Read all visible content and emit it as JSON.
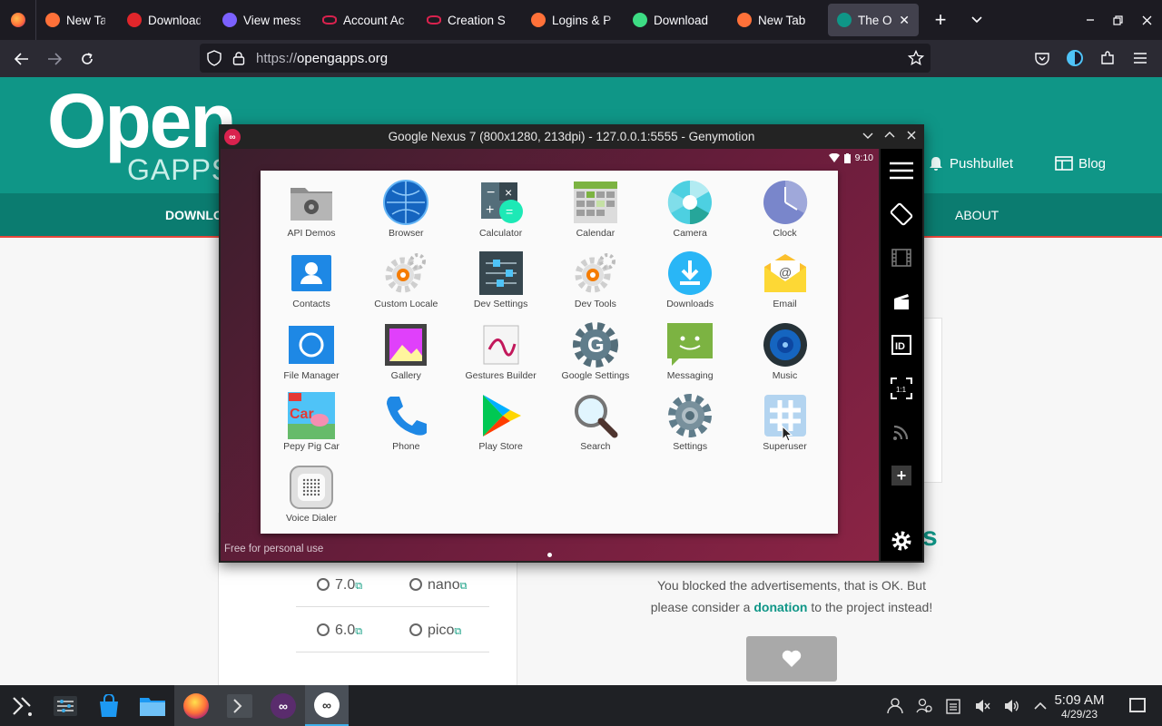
{
  "browser": {
    "tabs": [
      {
        "title": "New Tab",
        "icon": "firefox-icon",
        "color": "#ff7139"
      },
      {
        "title": "Download",
        "icon": "v-icon",
        "color": "#e0262b"
      },
      {
        "title": "View mess",
        "icon": "at-icon",
        "color": "#7b61ff"
      },
      {
        "title": "Account Ac",
        "icon": "genymotion-icon",
        "color": "#d9224e"
      },
      {
        "title": "Creation S",
        "icon": "genymotion-icon",
        "color": "#d9224e"
      },
      {
        "title": "Logins & P",
        "icon": "firefox-icon",
        "color": "#ff7139"
      },
      {
        "title": "Download",
        "icon": "android-icon",
        "color": "#3ddc84"
      },
      {
        "title": "New Tab",
        "icon": "firefox-icon",
        "color": "#ff7139"
      },
      {
        "title": "The Ope",
        "icon": "opengapps-icon",
        "color": "#0f9687"
      }
    ],
    "url_scheme": "https://",
    "url_host": "opengapps.org"
  },
  "site": {
    "logo_big": "Open",
    "logo_small": "GAPPS",
    "header_links": [
      {
        "label": "Pushbullet",
        "icon": "bell-icon"
      },
      {
        "label": "Blog",
        "icon": "blog-icon"
      }
    ],
    "nav": [
      "DOWNLO",
      "ABOUT"
    ],
    "variants": [
      [
        "7.0",
        "nano"
      ],
      [
        "6.0",
        "pico"
      ]
    ],
    "heading_fragment": "s",
    "blocked_line1": "You blocked the advertisements, that is OK. But",
    "blocked_line2_pre": "please consider a ",
    "blocked_link": "donation",
    "blocked_line2_post": " to the project instead!"
  },
  "genymotion": {
    "title": "Google Nexus 7 (800x1280, 213dpi) - 127.0.0.1:5555 - Genymotion",
    "status_time": "9:10",
    "watermark": "Free for personal use",
    "apps": [
      {
        "label": "API Demos",
        "icon": "folder-gear-icon"
      },
      {
        "label": "Browser",
        "icon": "globe-icon"
      },
      {
        "label": "Calculator",
        "icon": "calculator-icon"
      },
      {
        "label": "Calendar",
        "icon": "calendar-icon"
      },
      {
        "label": "Camera",
        "icon": "camera-icon"
      },
      {
        "label": "Clock",
        "icon": "clock-icon"
      },
      {
        "label": "Contacts",
        "icon": "contacts-icon"
      },
      {
        "label": "Custom Locale",
        "icon": "gear-icon"
      },
      {
        "label": "Dev Settings",
        "icon": "sliders-icon"
      },
      {
        "label": "Dev Tools",
        "icon": "gear-icon"
      },
      {
        "label": "Downloads",
        "icon": "download-icon"
      },
      {
        "label": "Email",
        "icon": "email-icon"
      },
      {
        "label": "File Manager",
        "icon": "file-manager-icon"
      },
      {
        "label": "Gallery",
        "icon": "gallery-icon"
      },
      {
        "label": "Gestures Builder",
        "icon": "gestures-icon"
      },
      {
        "label": "Google Settings",
        "icon": "google-settings-icon"
      },
      {
        "label": "Messaging",
        "icon": "messaging-icon"
      },
      {
        "label": "Music",
        "icon": "speaker-icon"
      },
      {
        "label": "Pepy Pig Car",
        "icon": "pepy-pig-car-icon"
      },
      {
        "label": "Phone",
        "icon": "phone-icon"
      },
      {
        "label": "Play Store",
        "icon": "play-store-icon"
      },
      {
        "label": "Search",
        "icon": "magnifier-icon"
      },
      {
        "label": "Settings",
        "icon": "settings-icon"
      },
      {
        "label": "Superuser",
        "icon": "superuser-icon"
      },
      {
        "label": "Voice Dialer",
        "icon": "voice-dialer-icon"
      }
    ],
    "side_tools": [
      "menu-icon",
      "rotate-icon",
      "film-icon",
      "clapper-icon",
      "id-icon",
      "pixel-perfect-icon",
      "wifi-icon",
      "plus-icon",
      "settings-icon"
    ]
  },
  "taskbar": {
    "time": "5:09 AM",
    "date": "4/29/23",
    "apps": [
      "app-launcher-icon",
      "system-settings-icon",
      "discover-icon",
      "dolphin-icon",
      "firefox-icon",
      "konsole-icon",
      "genymotion-icon",
      "genymotion-icon"
    ],
    "tray": [
      "user-icon",
      "users-icon",
      "clipboard-icon",
      "mute-icon",
      "volume-icon",
      "chevron-up-icon"
    ]
  }
}
